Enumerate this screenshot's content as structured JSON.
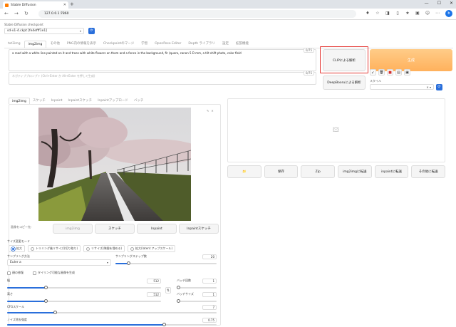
{
  "browser": {
    "tab_title": "Stable Diffusion",
    "url": "127.0.0.1:7860"
  },
  "checkpoint": {
    "label": "Stable Diffusion checkpoint",
    "value": "sd-v1-4.ckpt [fe4efff1e1]"
  },
  "main_tabs": [
    "txt2img",
    "img2img",
    "その他",
    "PNG内の情報を表示",
    "Checkpointのマージ",
    "学習",
    "OpenPose Editor",
    "Depth ライブラリ",
    "設定",
    "拡張機能"
  ],
  "prompt": {
    "positive": "a road with a white line painted on it and trees with white flowers on them and a fence in the background, fir (quero, canon 5 D mm, a tilt shift photo, color field",
    "positive_count": "0/75",
    "negative_placeholder": "ネガティブプロンプト (Ctrl+Enter か Alt+Enter を押して生成)",
    "negative_count": "0/75"
  },
  "buttons": {
    "clip": "CLIPによる解析",
    "generate": "生成",
    "deepbooru": "DeepBooruによる解析"
  },
  "style": {
    "label": "スタイル"
  },
  "sub_tabs": [
    "img2img",
    "スケッチ",
    "Inpaint",
    "Inpaintスケッチ",
    "Inpaintアップロード",
    "バッチ"
  ],
  "copy": {
    "label": "画像をコピー先:",
    "buttons": [
      "img2img",
      "スケッチ",
      "Inpaint",
      "Inpaintスケッチ"
    ]
  },
  "output_buttons": [
    "📁",
    "保存",
    "Zip",
    "img2imgに転送",
    "inpaintに転送",
    "その他に転送"
  ],
  "resize": {
    "label": "サイズ変更モード",
    "options": [
      "拡大",
      "トリミング後リサイズ(切り取り)",
      "リサイズ(隙間を埋める)",
      "拡大(latent アップスケール)"
    ]
  },
  "sampler": {
    "label": "サンプリング方法",
    "value": "Euler a"
  },
  "steps": {
    "label": "サンプリングステップ数",
    "value": "20",
    "fraction": 0.13
  },
  "checks": [
    "顔の修復",
    "タイリング可能な画像を生成"
  ],
  "width": {
    "label": "幅",
    "value": "512",
    "fraction": 0.25
  },
  "height": {
    "label": "高さ",
    "value": "512",
    "fraction": 0.25
  },
  "batch_count": {
    "label": "バッチ回数",
    "value": "1",
    "fraction": 0.0
  },
  "batch_size": {
    "label": "バッチサイズ",
    "value": "1",
    "fraction": 0.0
  },
  "cfg": {
    "label": "CFGスケール",
    "value": "7",
    "fraction": 0.23
  },
  "denoise": {
    "label": "ノイズ除去強度",
    "value": "0.75",
    "fraction": 0.75
  }
}
